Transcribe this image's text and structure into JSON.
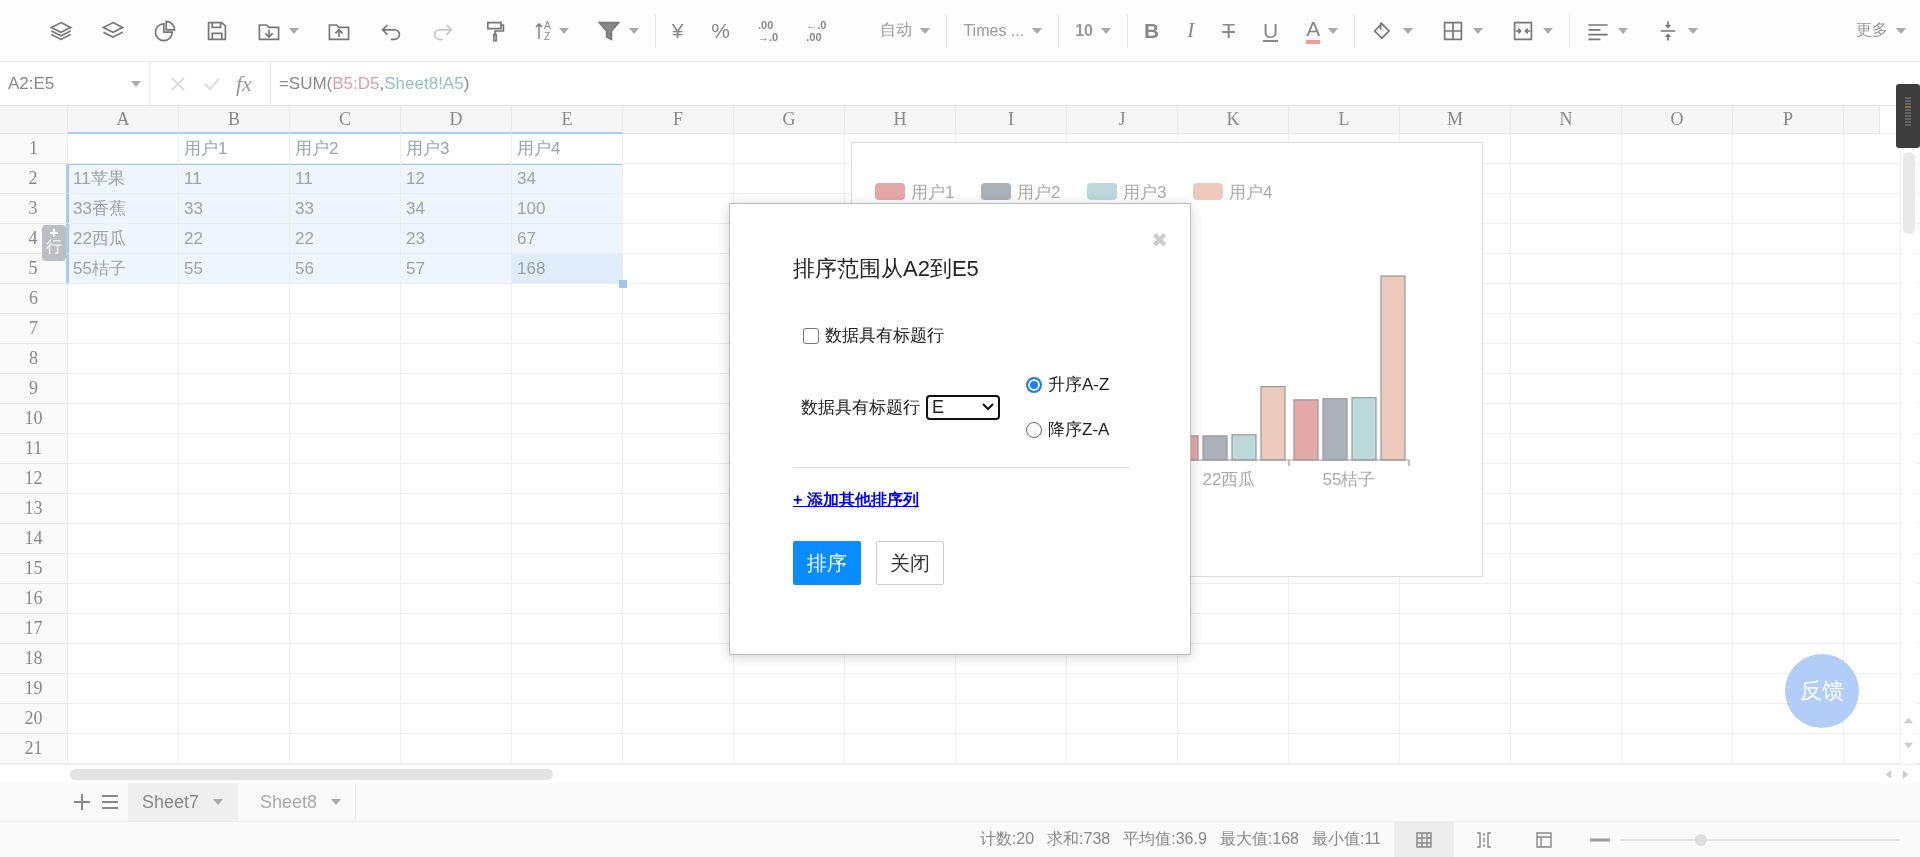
{
  "toolbar": {
    "sort_letters": [
      "A",
      "Z"
    ],
    "currency": "¥",
    "percent": "%",
    "decimal_add": [
      ".00",
      "→.0"
    ],
    "decimal_remove": [
      "←.0",
      ".00"
    ],
    "number_format": "自动",
    "font": "Times ...",
    "font_size": "10",
    "bold": "B",
    "italic": "I",
    "strikethrough": "T",
    "underline": "U",
    "font_color": "A",
    "more": "更多"
  },
  "formula_bar": {
    "cell_range": "A2:E5",
    "fx": "fx",
    "formula": [
      {
        "text": "=SUM("
      },
      {
        "text": "B5:D5",
        "color": "#e59c9c"
      },
      {
        "text": ","
      },
      {
        "text": "Sheet8!A5",
        "color": "#93c0c4"
      },
      {
        "text": ")"
      }
    ]
  },
  "sheet": {
    "columns": [
      {
        "label": "A",
        "selected": true
      },
      {
        "label": "B",
        "selected": true
      },
      {
        "label": "C",
        "selected": true
      },
      {
        "label": "D",
        "selected": true
      },
      {
        "label": "E",
        "selected": true
      },
      {
        "label": "F",
        "selected": false
      },
      {
        "label": "G",
        "selected": false
      },
      {
        "label": "H",
        "selected": false
      },
      {
        "label": "I",
        "selected": false
      },
      {
        "label": "J",
        "selected": false
      },
      {
        "label": "K",
        "selected": false
      },
      {
        "label": "L",
        "selected": false
      },
      {
        "label": "M",
        "selected": false
      },
      {
        "label": "N",
        "selected": false
      },
      {
        "label": "O",
        "selected": false
      },
      {
        "label": "P",
        "selected": false
      }
    ],
    "rows": [
      {
        "label": "1",
        "selected": false,
        "cells": [
          null,
          {
            "text": "用户1",
            "active": false
          },
          {
            "text": "用户2",
            "active": false
          },
          {
            "text": "用户3",
            "active": false
          },
          {
            "text": "用户4",
            "active": false
          }
        ]
      },
      {
        "label": "2",
        "selected": true,
        "cells": [
          {
            "text": "11苹果",
            "active": false
          },
          {
            "text": "11",
            "active": false
          },
          {
            "text": "11",
            "active": false
          },
          {
            "text": "12",
            "active": false
          },
          {
            "text": "34",
            "active": false
          }
        ]
      },
      {
        "label": "3",
        "selected": true,
        "cells": [
          {
            "text": "33香蕉",
            "active": false
          },
          {
            "text": "33",
            "active": false
          },
          {
            "text": "33",
            "active": false
          },
          {
            "text": "34",
            "active": false
          },
          {
            "text": "100",
            "active": false
          }
        ]
      },
      {
        "label": "4",
        "selected": true,
        "cells": [
          {
            "text": "22西瓜",
            "active": false
          },
          {
            "text": "22",
            "active": false
          },
          {
            "text": "22",
            "active": false
          },
          {
            "text": "23",
            "active": false
          },
          {
            "text": "67",
            "active": false
          }
        ]
      },
      {
        "label": "5",
        "selected": true,
        "cells": [
          {
            "text": "55桔子",
            "active": false
          },
          {
            "text": "55",
            "active": false
          },
          {
            "text": "56",
            "active": false
          },
          {
            "text": "57",
            "active": false
          },
          {
            "text": "168",
            "active": true
          }
        ]
      },
      {
        "label": "6",
        "selected": false
      },
      {
        "label": "7",
        "selected": false
      },
      {
        "label": "8",
        "selected": false
      },
      {
        "label": "9",
        "selected": false
      },
      {
        "label": "10",
        "selected": false
      },
      {
        "label": "11",
        "selected": false
      },
      {
        "label": "12",
        "selected": false
      },
      {
        "label": "13",
        "selected": false
      },
      {
        "label": "14",
        "selected": false
      },
      {
        "label": "15",
        "selected": false
      },
      {
        "label": "16",
        "selected": false
      },
      {
        "label": "17",
        "selected": false
      },
      {
        "label": "18",
        "selected": false
      },
      {
        "label": "19",
        "selected": false
      },
      {
        "label": "20",
        "selected": false
      },
      {
        "label": "21",
        "selected": false
      }
    ],
    "row_badge": "行",
    "chart": {
      "series": [
        {
          "name": "用户1",
          "color": "#e5a9a8"
        },
        {
          "name": "用户2",
          "color": "#aab1b9"
        },
        {
          "name": "用户3",
          "color": "#bcd8db"
        },
        {
          "name": "用户4",
          "color": "#ecc9bc"
        }
      ],
      "groups": [
        {
          "label": "22西瓜",
          "bars": [
            {
              "level": 0.131
            },
            {
              "level": 0.131
            },
            {
              "level": 0.137
            },
            {
              "level": 0.399
            }
          ]
        },
        {
          "label": "55桔子",
          "bars": [
            {
              "level": 0.327
            },
            {
              "level": 0.333
            },
            {
              "level": 0.339
            },
            {
              "level": 1.0
            }
          ]
        }
      ]
    },
    "feedback": "反馈"
  },
  "dialog": {
    "title": "排序范围从A2到E5",
    "close": "✖",
    "header_checkbox": {
      "label": "数据具有标题行",
      "checked": false
    },
    "column_label": "数据具有标题行",
    "column_select": "E",
    "order": [
      {
        "label": "升序A-Z",
        "selected": true
      },
      {
        "label": "降序Z-A",
        "selected": false
      }
    ],
    "add_link": "+ 添加其他排序列",
    "buttons": [
      {
        "label": "排序",
        "kind": "primary"
      },
      {
        "label": "关闭",
        "kind": "default"
      }
    ]
  },
  "sheet_tabs": [
    {
      "label": "Sheet7",
      "selected": true
    },
    {
      "label": "Sheet8",
      "selected": false
    }
  ],
  "status_bar": {
    "stats": [
      "计数:20",
      "求和:738",
      "平均值:36.9",
      "最大值:168",
      "最小值:11"
    ],
    "views": [
      {
        "selected": true
      },
      {
        "selected": false
      },
      {
        "selected": false
      }
    ],
    "zoom": {
      "level": 0.29
    }
  }
}
